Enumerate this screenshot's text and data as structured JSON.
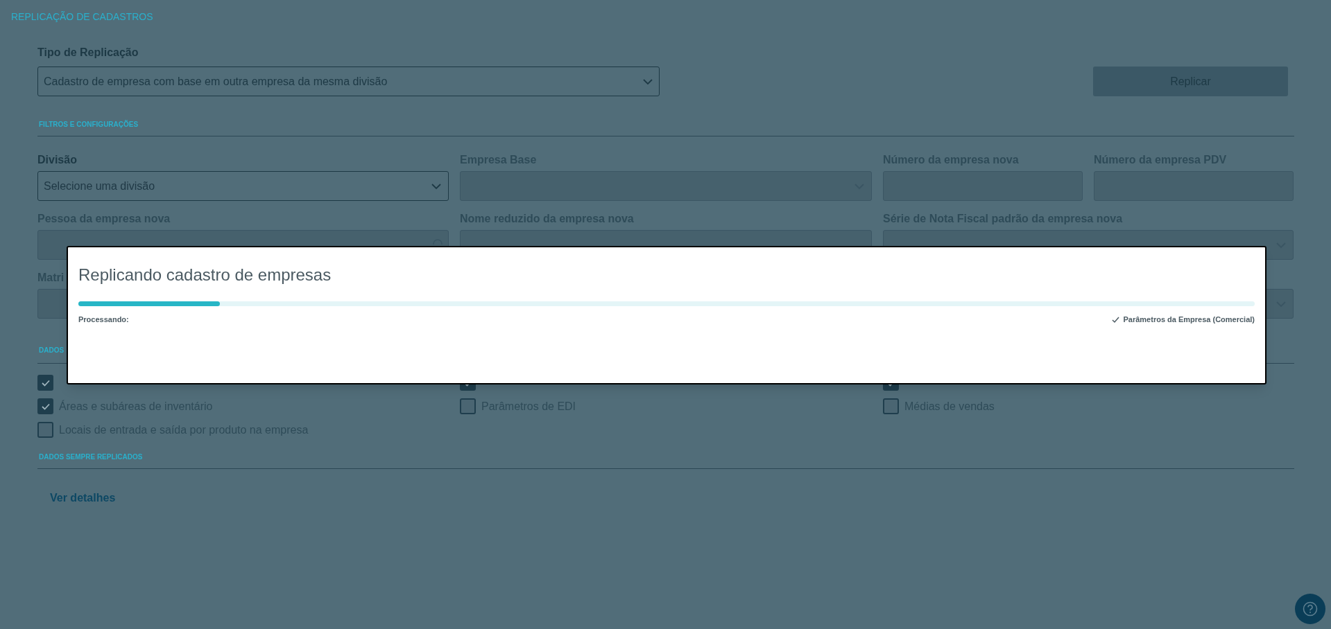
{
  "page_title": "REPLICAÇÃO DE CADASTROS",
  "replication_type": {
    "label": "Tipo de Replicação",
    "value": "Cadastro de empresa com base em outra empresa da mesma divisão"
  },
  "replicate_button": {
    "label": "Replicar",
    "disabled": true
  },
  "filters": {
    "heading": "FILTROS E CONFIGURAÇÕES",
    "rows": [
      [
        {
          "label": "Divisão",
          "kind": "select",
          "placeholder": "Selecione uma divisão",
          "disabled": false
        },
        {
          "label": "Empresa Base",
          "kind": "select",
          "disabled": true
        },
        {
          "label": "Número da empresa nova",
          "kind": "text",
          "disabled": true
        },
        {
          "label": "Número da empresa PDV",
          "kind": "text",
          "disabled": true
        }
      ],
      [
        {
          "label": "Pessoa da empresa nova",
          "kind": "search",
          "disabled": true
        },
        {
          "label": "Nome reduzido da empresa nova",
          "kind": "text",
          "disabled": true
        },
        {
          "label": "Série de Nota Fiscal padrão da empresa nova",
          "kind": "select",
          "disabled": true
        }
      ],
      [
        {
          "label": "Matri",
          "kind": "text",
          "disabled": true
        },
        {
          "kind": "select",
          "disabled": true
        }
      ]
    ]
  },
  "data_section": {
    "heading": "DADOS",
    "columns": [
      [
        {
          "checked": true
        },
        {
          "label": "Áreas e subáreas de inventário",
          "checked": true
        },
        {
          "label": "Locais de entrada e saída por produto na empresa",
          "checked": false
        }
      ],
      [
        {
          "checked": true
        },
        {
          "label": "Parâmetros de EDI",
          "checked": false
        }
      ],
      [
        {
          "checked": true
        },
        {
          "label": "Médias de vendas",
          "checked": false
        }
      ]
    ]
  },
  "always_section": {
    "heading": "DADOS SEMPRE REPLICADOS",
    "link": "Ver detalhes"
  },
  "modal": {
    "title": "Replicando cadastro de empresas",
    "progress": {
      "level": 0.12
    },
    "status_label": "Processando:",
    "current_step": "Parâmetros da Empresa (Comercial)"
  }
}
